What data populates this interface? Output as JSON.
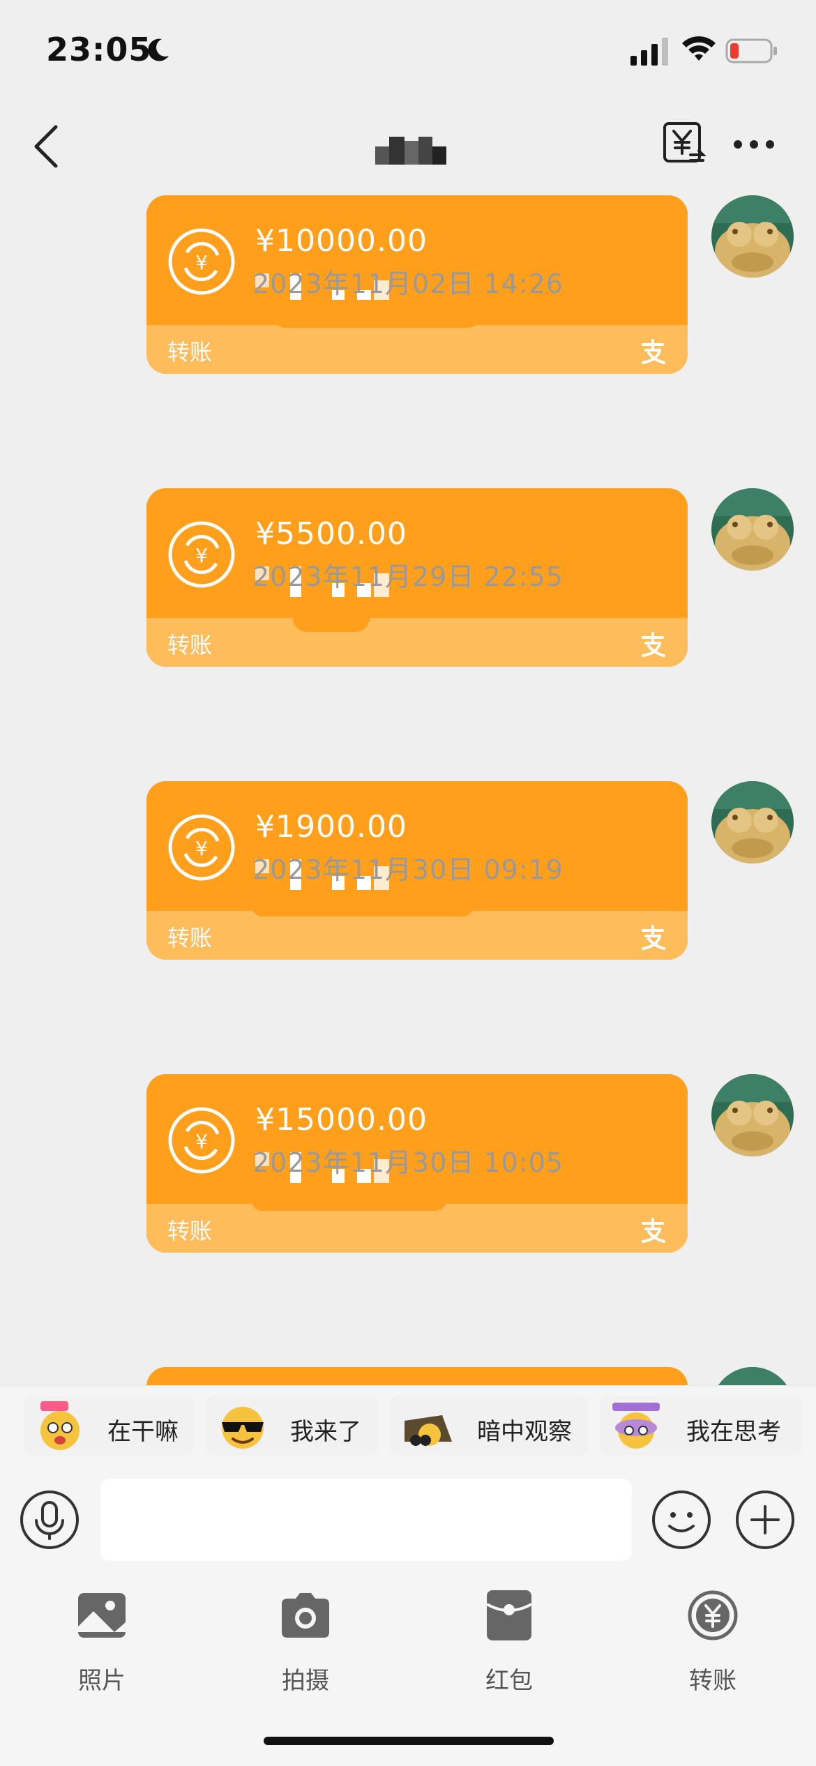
{
  "status_bar": {
    "time": "23:05"
  },
  "header": {
    "back_icon": "chevron-left-icon",
    "exchange_icon": "yuan-exchange-icon",
    "more_icon": "more-dots-icon"
  },
  "colors": {
    "card": "#ff9f1c",
    "card_bottom": "#ffbc5a",
    "timestamp": "#999999",
    "background": "#efefef"
  },
  "messages": [
    {
      "amount": "¥10000.00",
      "label": "转账",
      "timestamp": ""
    },
    {
      "amount": "¥5500.00",
      "label": "转账",
      "timestamp": "2023年11月02日 14:26"
    },
    {
      "amount": "¥1900.00",
      "label": "转账",
      "timestamp": "2023年11月29日 22:55"
    },
    {
      "amount": "¥15000.00",
      "label": "转账",
      "timestamp": "2023年11月30日 09:19"
    },
    {
      "amount": "",
      "label": "",
      "timestamp": "2023年11月30日 10:05"
    }
  ],
  "stickers": [
    {
      "label": "在干嘛",
      "icon": "zaiganma-sticker-icon"
    },
    {
      "label": "我来了",
      "icon": "sunglasses-sticker-icon"
    },
    {
      "label": "暗中观察",
      "icon": "peek-sticker-icon"
    },
    {
      "label": "我在思考",
      "icon": "thinking-sticker-icon"
    }
  ],
  "input": {
    "value": "",
    "placeholder": ""
  },
  "toolbar": [
    {
      "label": "照片",
      "icon": "photo-icon"
    },
    {
      "label": "拍摄",
      "icon": "camera-icon"
    },
    {
      "label": "红包",
      "icon": "red-packet-icon"
    },
    {
      "label": "转账",
      "icon": "transfer-icon"
    }
  ]
}
